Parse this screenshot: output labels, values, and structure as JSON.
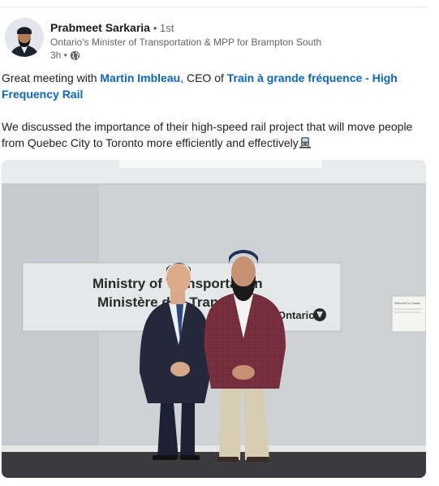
{
  "post": {
    "author": {
      "name": "Prabmeet Sarkaria",
      "degree": "• 1st",
      "headline": "Ontario's Minister of Transportation & MPP for Brampton South",
      "time": "3h •"
    },
    "body": {
      "p1_before": "Great meeting with ",
      "mention_person": "Martin Imbleau",
      "p1_middle": ", CEO of ",
      "mention_company": "Train à grande fréquence - High Frequency Rail",
      "p2": "We discussed the importance of their high-speed rail project that will move people from Quebec City to Toronto more efficiently and effectively"
    },
    "photo": {
      "sign_line1": "Ministry of Transportation",
      "sign_line2": "Ministère des Transports",
      "sign_brand": "Ontario",
      "notice_text": "Welcome to Ontario"
    },
    "icons": {
      "globe": "globe-icon",
      "train": "train-icon"
    },
    "colors": {
      "link": "#0a66c2",
      "secondary_text": "#666666",
      "name_text": "#191919"
    }
  }
}
